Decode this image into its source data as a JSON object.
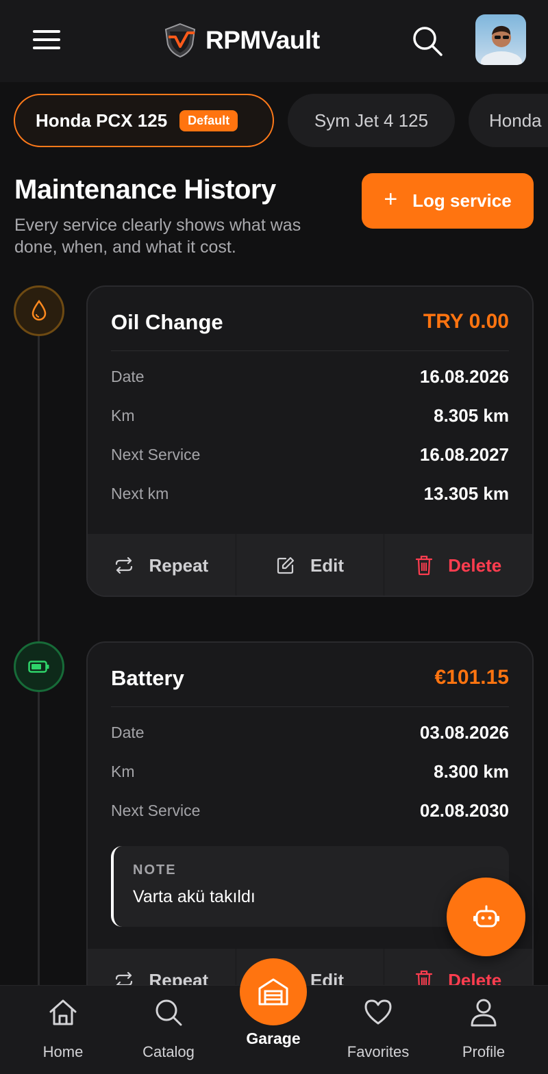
{
  "header": {
    "app_name": "RPMVault"
  },
  "vehicles": [
    {
      "name": "Honda PCX 125",
      "badge": "Default",
      "active": true
    },
    {
      "name": "Sym Jet 4 125",
      "active": false
    },
    {
      "name": "Honda",
      "active": false
    }
  ],
  "page": {
    "title": "Maintenance History",
    "subtitle": "Every service clearly shows what was done, when, and what it cost.",
    "log_button": "Log service"
  },
  "services": [
    {
      "title": "Oil Change",
      "cost": "TRY 0.00",
      "icon": "oil-drop-icon",
      "rows": [
        {
          "label": "Date",
          "value": "16.08.2026"
        },
        {
          "label": "Km",
          "value": "8.305 km"
        },
        {
          "label": "Next Service",
          "value": "16.08.2027"
        },
        {
          "label": "Next km",
          "value": "13.305 km"
        }
      ],
      "actions": {
        "repeat": "Repeat",
        "edit": "Edit",
        "delete": "Delete"
      }
    },
    {
      "title": "Battery",
      "cost": "€101.15",
      "icon": "battery-icon",
      "rows": [
        {
          "label": "Date",
          "value": "03.08.2026"
        },
        {
          "label": "Km",
          "value": "8.300 km"
        },
        {
          "label": "Next Service",
          "value": "02.08.2030"
        }
      ],
      "note": {
        "label": "NOTE",
        "text": "Varta akü takıldı"
      },
      "actions": {
        "repeat": "Repeat",
        "edit": "Edit",
        "delete": "Delete"
      }
    }
  ],
  "bottom_nav": {
    "home": "Home",
    "catalog": "Catalog",
    "garage": "Garage",
    "favorites": "Favorites",
    "profile": "Profile"
  },
  "colors": {
    "accent": "#ff7410",
    "delete": "#ff3d4f",
    "background": "#111112",
    "card": "#19191b"
  }
}
